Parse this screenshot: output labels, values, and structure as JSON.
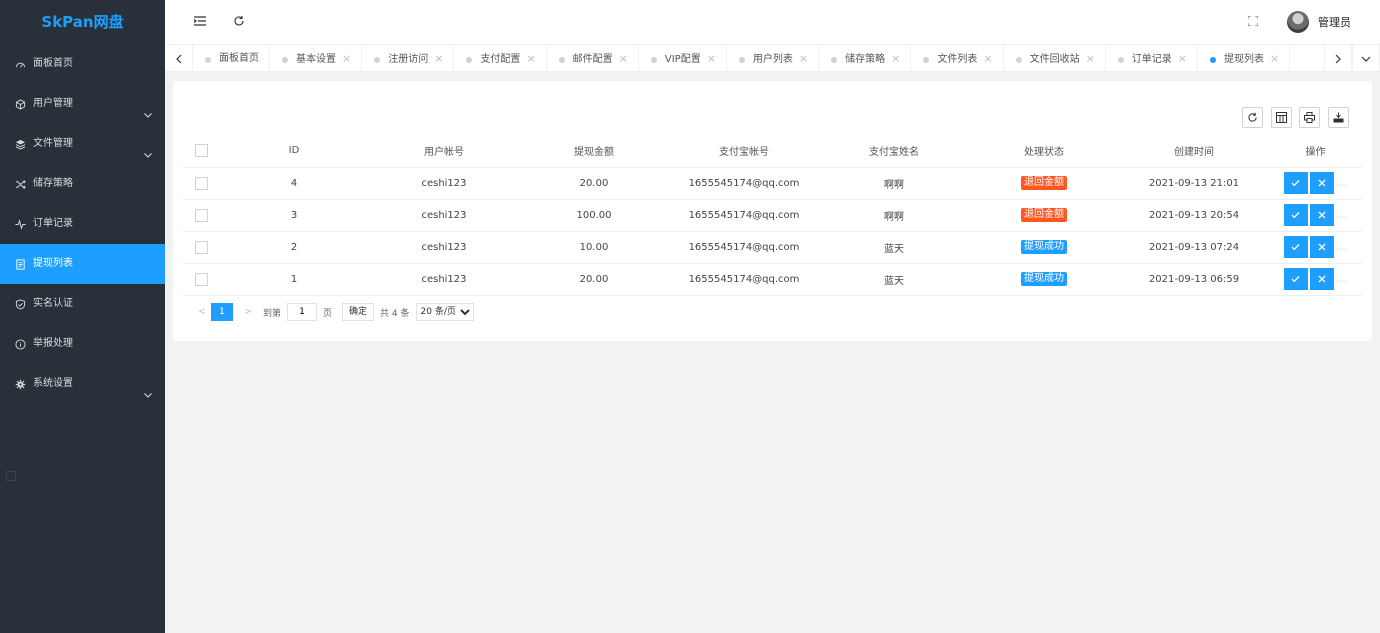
{
  "app": {
    "logo": "SkPan网盘"
  },
  "sidebar": {
    "items": [
      {
        "label": "面板首页",
        "icon": "dashboard-icon",
        "has_children": false,
        "active": false
      },
      {
        "label": "用户管理",
        "icon": "cube-icon",
        "has_children": true,
        "active": false
      },
      {
        "label": "文件管理",
        "icon": "layers-icon",
        "has_children": true,
        "active": false
      },
      {
        "label": "储存策略",
        "icon": "shuffle-icon",
        "has_children": false,
        "active": false
      },
      {
        "label": "订单记录",
        "icon": "pulse-icon",
        "has_children": false,
        "active": false
      },
      {
        "label": "提现列表",
        "icon": "document-icon",
        "has_children": false,
        "active": true
      },
      {
        "label": "实名认证",
        "icon": "shield-check-icon",
        "has_children": false,
        "active": false
      },
      {
        "label": "举报处理",
        "icon": "info-icon",
        "has_children": false,
        "active": false
      },
      {
        "label": "系统设置",
        "icon": "gear-icon",
        "has_children": true,
        "active": false
      }
    ]
  },
  "header": {
    "user_name": "管理员",
    "icons": [
      "menu-fold-icon",
      "refresh-icon",
      "fullscreen-icon",
      "avatar"
    ]
  },
  "tabs": [
    {
      "label": "面板首页",
      "closable": false,
      "active": false
    },
    {
      "label": "基本设置",
      "closable": true,
      "active": false
    },
    {
      "label": "注册访问",
      "closable": true,
      "active": false
    },
    {
      "label": "支付配置",
      "closable": true,
      "active": false
    },
    {
      "label": "邮件配置",
      "closable": true,
      "active": false
    },
    {
      "label": "VIP配置",
      "closable": true,
      "active": false
    },
    {
      "label": "用户列表",
      "closable": true,
      "active": false
    },
    {
      "label": "储存策略",
      "closable": true,
      "active": false
    },
    {
      "label": "文件列表",
      "closable": true,
      "active": false
    },
    {
      "label": "文件回收站",
      "closable": true,
      "active": false
    },
    {
      "label": "订单记录",
      "closable": true,
      "active": false
    },
    {
      "label": "提现列表",
      "closable": true,
      "active": true
    }
  ],
  "table": {
    "columns": [
      "ID",
      "用户帐号",
      "提现金额",
      "支付宝帐号",
      "支付宝姓名",
      "处理状态",
      "创建时间",
      "操作"
    ],
    "rows": [
      {
        "id": "4",
        "account": "ceshi123",
        "amount": "20.00",
        "alipay": "1655545174@qq.com",
        "name": "啊啊",
        "status": "退回金额",
        "status_color": "#ff5722",
        "created": "2021-09-13 21:01"
      },
      {
        "id": "3",
        "account": "ceshi123",
        "amount": "100.00",
        "alipay": "1655545174@qq.com",
        "name": "啊啊",
        "status": "退回金额",
        "status_color": "#ff5722",
        "created": "2021-09-13 20:54"
      },
      {
        "id": "2",
        "account": "ceshi123",
        "amount": "10.00",
        "alipay": "1655545174@qq.com",
        "name": "蓝天",
        "status": "提现成功",
        "status_color": "#1e9fff",
        "created": "2021-09-13 07:24"
      },
      {
        "id": "1",
        "account": "ceshi123",
        "amount": "20.00",
        "alipay": "1655545174@qq.com",
        "name": "蓝天",
        "status": "提现成功",
        "status_color": "#1e9fff",
        "created": "2021-09-13 06:59"
      }
    ]
  },
  "pager": {
    "current": "1",
    "goto_label": "到第",
    "goto_value": "1",
    "page_unit": "页",
    "confirm": "确定",
    "total": "共 4 条",
    "page_size": "20 条/页"
  },
  "colors": {
    "sidebar_bg": "#28303a",
    "accent": "#1e9fff",
    "danger": "#ff5722"
  }
}
